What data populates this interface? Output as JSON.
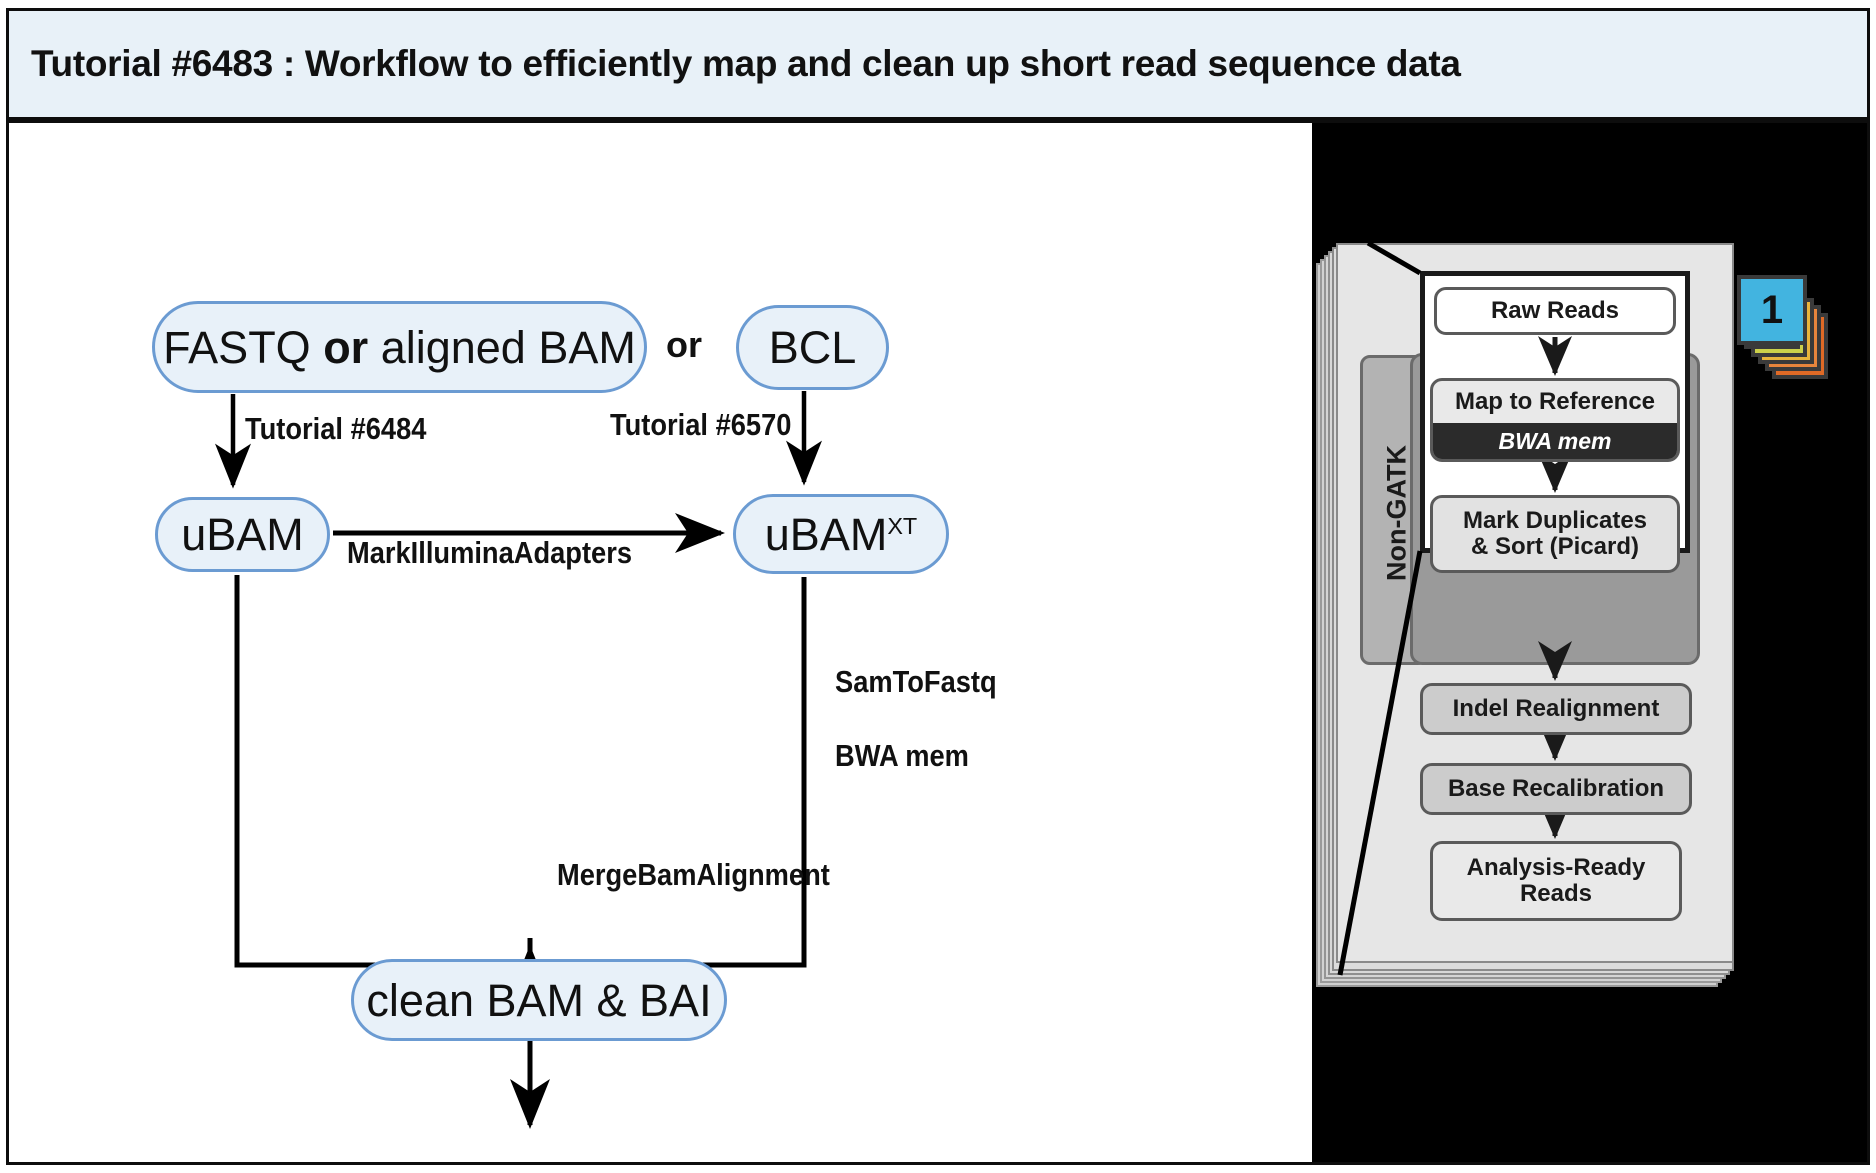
{
  "title": "Tutorial #6483 : Workflow to efficiently map and clean up short read sequence data",
  "colors": {
    "node_fill": "#e8f1f9",
    "node_border": "#6b9bd2",
    "title_bg": "#e8f1f8",
    "frame": "#0d0d0d",
    "gatk_pane_bg": "#000000",
    "badge": "#42b4e0",
    "bwa_bar": "#2b2b2b"
  },
  "workflow": {
    "nodes": {
      "fastq": {
        "text_plain_1": "FASTQ ",
        "text_bold": "or",
        "text_plain_2": " aligned BAM"
      },
      "bcl": {
        "label": "BCL"
      },
      "ubam": {
        "label": "uBAM"
      },
      "ubam_xt": {
        "base": "uBAM",
        "sup": "XT"
      },
      "clean": {
        "label": "clean BAM & BAI"
      }
    },
    "labels": {
      "or": "or",
      "tutorial_6484": "Tutorial #6484",
      "tutorial_6570": "Tutorial #6570",
      "mark_illumina_adapters": "MarkIlluminaAdapters",
      "samtofastq": "SamToFastq",
      "bwa_mem": "BWA mem",
      "merge_bam_alignment": "MergeBamAlignment"
    }
  },
  "gatk_panel": {
    "badge": "1",
    "band_label": "Non-GATK",
    "steps": {
      "raw_reads": "Raw Reads",
      "map_to_reference": "Map to Reference",
      "map_tool": "BWA mem",
      "mark_duplicates_line1": "Mark Duplicates",
      "mark_duplicates_line2": "& Sort (Picard)",
      "indel_realignment": "Indel Realignment",
      "base_recalibration": "Base Recalibration",
      "analysis_ready_line1": "Analysis-Ready",
      "analysis_ready_line2": "Reads"
    },
    "tab_colors": [
      "#42b4e0",
      "#7bb98a",
      "#ccd14a",
      "#e8b43c",
      "#e8853c",
      "#e06a26"
    ]
  }
}
